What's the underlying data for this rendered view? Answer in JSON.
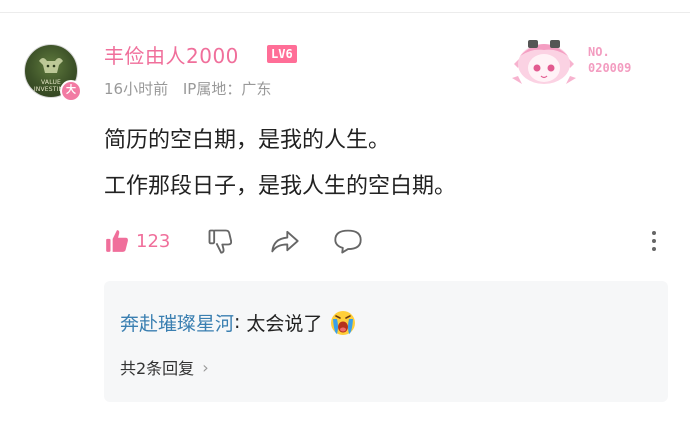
{
  "post": {
    "username": "丰俭由人2000",
    "level": "LV6",
    "avatar_badge": "大",
    "avatar_text": "VALUE INVESTING",
    "time": "16小时前",
    "ip_location": "IP属地：广东",
    "fan_label": "NO.",
    "fan_number": "020009",
    "content_lines": [
      "简历的空白期，是我的人生。",
      "工作那段日子，是我人生的空白期。"
    ]
  },
  "actions": {
    "like_count": "123",
    "icons": [
      "thumb-up-icon",
      "thumb-down-icon",
      "share-icon",
      "comment-icon",
      "more-icon"
    ]
  },
  "reply": {
    "user": "奔赴璀璨星河",
    "colon": ":",
    "text": "太会说了",
    "emoji": "crying-emoji-icon",
    "total": "共2条回复",
    "chevron": "›"
  },
  "colors": {
    "accent_pink": "#f06f9b",
    "level_bg": "#ff6e97",
    "reply_user": "#3a7fb1",
    "reply_bg": "#f6f7f8"
  }
}
